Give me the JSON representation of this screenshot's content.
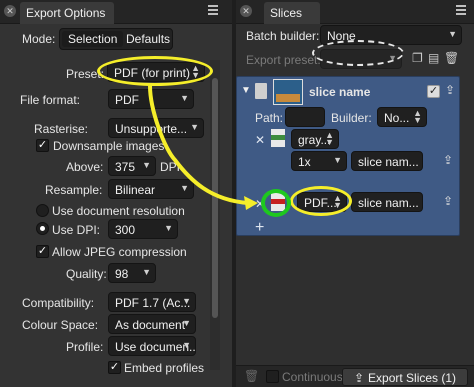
{
  "left": {
    "tab_title": "Export Options",
    "mode_label": "Mode:",
    "mode_options": [
      "Selection",
      "Defaults"
    ],
    "preset_label": "Preset:",
    "preset_value": "PDF (for print)",
    "file_format_label": "File format:",
    "file_format_value": "PDF",
    "rasterise_label": "Rasterise:",
    "rasterise_value": "Unsupporte...",
    "downsample_label": "Downsample images",
    "above_label": "Above:",
    "above_value": "375",
    "dpi_label": "DPI",
    "resample_label": "Resample:",
    "resample_value": "Bilinear",
    "use_doc_res_label": "Use document resolution",
    "use_dpi_label": "Use DPI:",
    "use_dpi_value": "300",
    "allow_jpeg_label": "Allow JPEG compression",
    "quality_label": "Quality:",
    "quality_value": "98",
    "compat_label": "Compatibility:",
    "compat_value": "PDF 1.7 (Ac...",
    "colour_space_label": "Colour Space:",
    "colour_space_value": "As document",
    "profile_label": "Profile:",
    "profile_value": "Use documen...",
    "embed_profiles_label": "Embed profiles"
  },
  "right": {
    "tab_title": "Slices",
    "batch_builder_label": "Batch builder:",
    "batch_builder_value": "None",
    "export_preset_label": "Export preset:",
    "slice_name": "slice name",
    "path_label": "Path:",
    "builder_label": "Builder:",
    "builder_value": "No...",
    "format_row1_value": "gray...",
    "scale_value": "1x",
    "slice_name_field1": "slice nam...",
    "format_row2_value": "PDF...",
    "slice_name_field2": "slice nam...",
    "continuous_label": "Continuous",
    "export_button": "Export Slices (1)"
  },
  "colors": {
    "highlight_yellow": "#f5ee2a",
    "highlight_green": "#1ec81e",
    "slice_card_blue": "#3f5a85"
  }
}
